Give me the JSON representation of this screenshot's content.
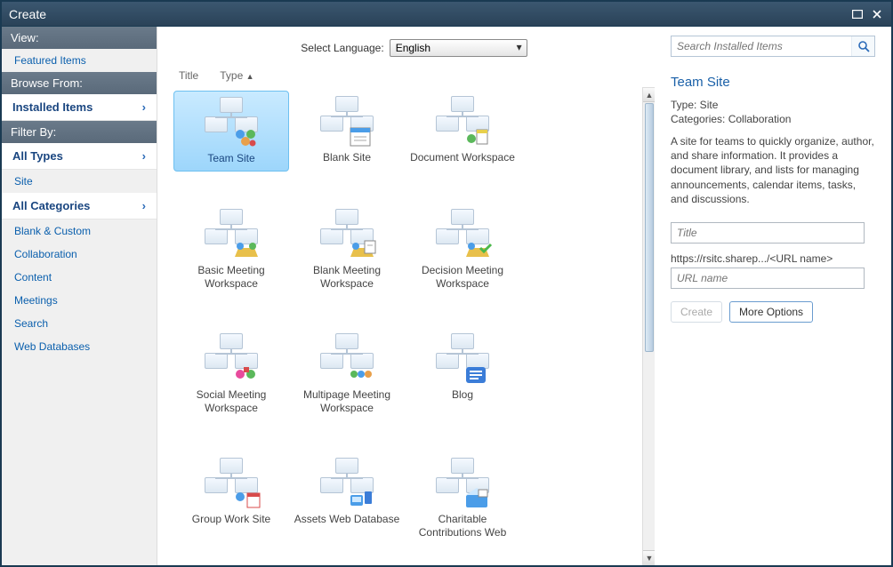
{
  "window": {
    "title": "Create"
  },
  "sidebar": {
    "view_header": "View:",
    "view_items": [
      "Featured Items"
    ],
    "browse_header": "Browse From:",
    "browse_expand": "Installed Items",
    "filter_header": "Filter By:",
    "types_expand": "All Types",
    "types_items": [
      "Site"
    ],
    "categories_expand": "All Categories",
    "categories_items": [
      "Blank & Custom",
      "Collaboration",
      "Content",
      "Meetings",
      "Search",
      "Web Databases"
    ]
  },
  "topbar": {
    "lang_label": "Select Language:",
    "lang_value": "English"
  },
  "columns": {
    "title": "Title",
    "type": "Type"
  },
  "tiles": [
    {
      "label": "Team Site",
      "selected": true
    },
    {
      "label": "Blank Site"
    },
    {
      "label": "Document Workspace"
    },
    {
      "label": "Basic Meeting Workspace"
    },
    {
      "label": "Blank Meeting Workspace"
    },
    {
      "label": "Decision Meeting Workspace"
    },
    {
      "label": "Social Meeting Workspace"
    },
    {
      "label": "Multipage Meeting Workspace"
    },
    {
      "label": "Blog"
    },
    {
      "label": "Group Work Site"
    },
    {
      "label": "Assets Web Database"
    },
    {
      "label": "Charitable Contributions Web"
    }
  ],
  "right": {
    "search_placeholder": "Search Installed Items",
    "title": "Team Site",
    "type_line": "Type: Site",
    "cat_line": "Categories: Collaboration",
    "desc": "A site for teams to quickly organize, author, and share information. It provides a document library, and lists for managing announcements, calendar items, tasks, and discussions.",
    "title_placeholder": "Title",
    "url_hint": "https://rsitc.sharep.../<URL name>",
    "url_placeholder": "URL name",
    "create_btn": "Create",
    "more_btn": "More Options"
  }
}
